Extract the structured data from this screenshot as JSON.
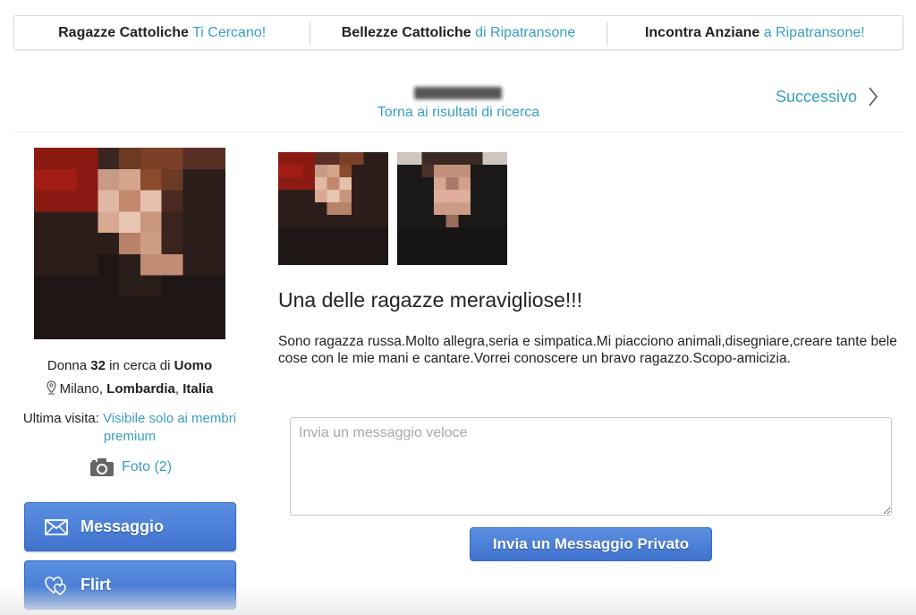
{
  "top_links": [
    {
      "bold": "Ragazze Cattoliche",
      "rest": "Ti Cercano!"
    },
    {
      "bold": "Bellezze Cattoliche",
      "rest": "di Ripatransone"
    },
    {
      "bold": "Incontra Anziane",
      "rest": "a Ripatransone!"
    }
  ],
  "nav": {
    "back_label": "Torna ai risultati di ricerca",
    "next_label": "Successivo"
  },
  "profile": {
    "gender": "Donna",
    "age": "32",
    "seeking_prefix": "in cerca di",
    "seeking": "Uomo",
    "city": "Milano",
    "region": "Lombardia",
    "country": "Italia",
    "last_visit_label": "Ultima visita:",
    "last_visit_value": "Visibile solo ai membri premium",
    "photos_label": "Foto (2)"
  },
  "actions": {
    "message_label": "Messaggio",
    "flirt_label": "Flirt"
  },
  "content": {
    "headline": "Una delle ragazze meravigliose!!!",
    "description": "Sono ragazza russa.Molto allegra,seria e simpatica.Mi piacciono animali,disegniare,creare tante bele cose con le mie mani e cantare.Vorrei conoscere un bravo ragazzo.Scopo-amicizia."
  },
  "message_form": {
    "placeholder": "Invia un messaggio veloce",
    "send_label": "Invia un Messaggio Privato"
  },
  "colors": {
    "link": "#3a9fc2",
    "button": "#4a7fd6"
  }
}
